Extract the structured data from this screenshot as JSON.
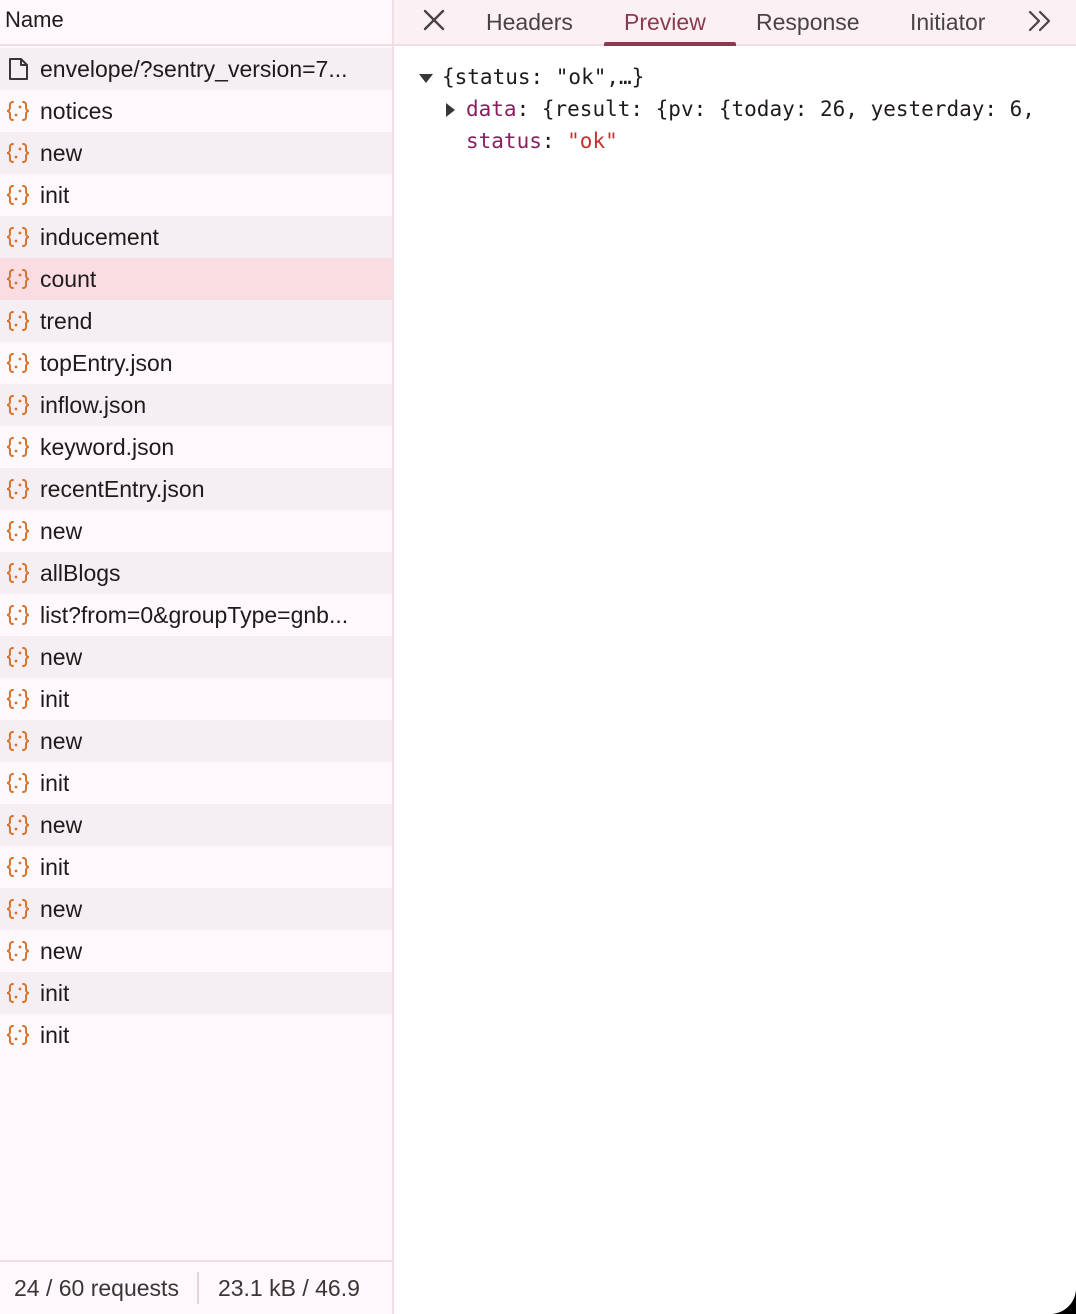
{
  "list": {
    "header": "Name",
    "rows": [
      {
        "name": "envelope/?sentry_version=7...",
        "icon": "document-icon"
      },
      {
        "name": "notices",
        "icon": "json-braces-icon"
      },
      {
        "name": "new",
        "icon": "json-braces-icon"
      },
      {
        "name": "init",
        "icon": "json-braces-icon"
      },
      {
        "name": "inducement",
        "icon": "json-braces-icon"
      },
      {
        "name": "count",
        "icon": "json-braces-icon"
      },
      {
        "name": "trend",
        "icon": "json-braces-icon"
      },
      {
        "name": "topEntry.json",
        "icon": "json-braces-icon"
      },
      {
        "name": "inflow.json",
        "icon": "json-braces-icon"
      },
      {
        "name": "keyword.json",
        "icon": "json-braces-icon"
      },
      {
        "name": "recentEntry.json",
        "icon": "json-braces-icon"
      },
      {
        "name": "new",
        "icon": "json-braces-icon"
      },
      {
        "name": "allBlogs",
        "icon": "json-braces-icon"
      },
      {
        "name": "list?from=0&groupType=gnb...",
        "icon": "json-braces-icon"
      },
      {
        "name": "new",
        "icon": "json-braces-icon"
      },
      {
        "name": "init",
        "icon": "json-braces-icon"
      },
      {
        "name": "new",
        "icon": "json-braces-icon"
      },
      {
        "name": "init",
        "icon": "json-braces-icon"
      },
      {
        "name": "new",
        "icon": "json-braces-icon"
      },
      {
        "name": "init",
        "icon": "json-braces-icon"
      },
      {
        "name": "new",
        "icon": "json-braces-icon"
      },
      {
        "name": "new",
        "icon": "json-braces-icon"
      },
      {
        "name": "init",
        "icon": "json-braces-icon"
      },
      {
        "name": "init",
        "icon": "json-braces-icon"
      }
    ],
    "selected_row": "count"
  },
  "status_bar": {
    "requests": "24 / 60 requests",
    "size": "23.1 kB / 46.9"
  },
  "tabs": {
    "headers": "Headers",
    "preview": "Preview",
    "response": "Response",
    "initiator": "Initiator",
    "active": "Preview"
  },
  "preview": {
    "root_summary": "{status: \"ok\",…}",
    "data_key": "data",
    "data_summary": "{result: {pv: {today: 26, yesterday: 6,",
    "status_key": "status",
    "status_value": "\"ok\""
  },
  "colors": {
    "accent": "#8b3a4f",
    "json_icon": "#d9732a",
    "selected_row": "#f9dde3",
    "key": "#8a1f5f",
    "string": "#c4322b"
  }
}
